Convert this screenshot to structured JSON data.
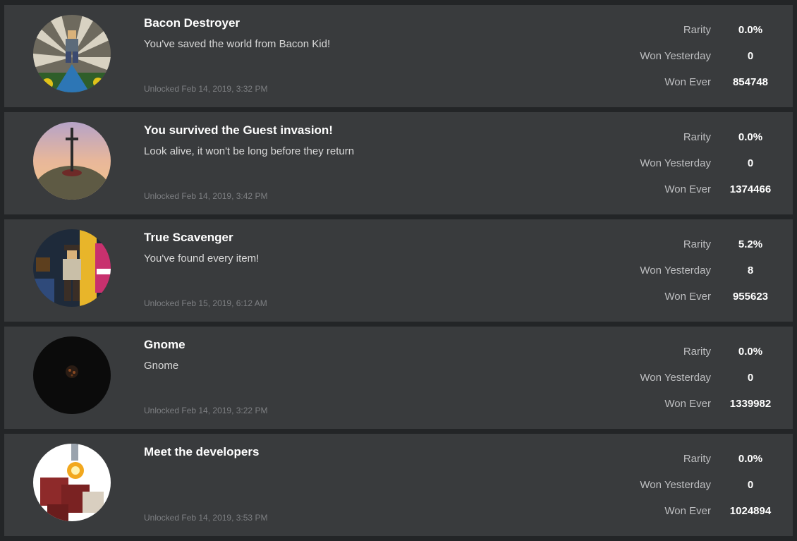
{
  "labels": {
    "rarity": "Rarity",
    "won_yesterday": "Won Yesterday",
    "won_ever": "Won Ever"
  },
  "badges": [
    {
      "title": "Bacon Destroyer",
      "description": "You've saved the world from Bacon Kid!",
      "unlocked": "Unlocked Feb 14, 2019, 3:32 PM",
      "rarity": "0.0%",
      "won_yesterday": "0",
      "won_ever": "854748",
      "icon": "bacon-destroyer-badge-icon"
    },
    {
      "title": "You survived the Guest invasion!",
      "description": "Look alive, it won't be long before they return",
      "unlocked": "Unlocked Feb 14, 2019, 3:42 PM",
      "rarity": "0.0%",
      "won_yesterday": "0",
      "won_ever": "1374466",
      "icon": "sword-in-hill-badge-icon"
    },
    {
      "title": "True Scavenger",
      "description": "You've found every item!",
      "unlocked": "Unlocked Feb 15, 2019, 6:12 AM",
      "rarity": "5.2%",
      "won_yesterday": "8",
      "won_ever": "955623",
      "icon": "scavenger-badge-icon"
    },
    {
      "title": "Gnome",
      "description": "Gnome",
      "unlocked": "Unlocked Feb 14, 2019, 3:22 PM",
      "rarity": "0.0%",
      "won_yesterday": "0",
      "won_ever": "1339982",
      "icon": "gnome-badge-icon"
    },
    {
      "title": "Meet the developers",
      "description": "",
      "unlocked": "Unlocked Feb 14, 2019, 3:53 PM",
      "rarity": "0.0%",
      "won_yesterday": "0",
      "won_ever": "1024894",
      "icon": "developers-badge-icon"
    }
  ],
  "colors": {
    "background": "#232527",
    "card": "#393b3d",
    "title": "#ffffff",
    "description": "#d9d9d9",
    "muted": "#7d7f82"
  }
}
